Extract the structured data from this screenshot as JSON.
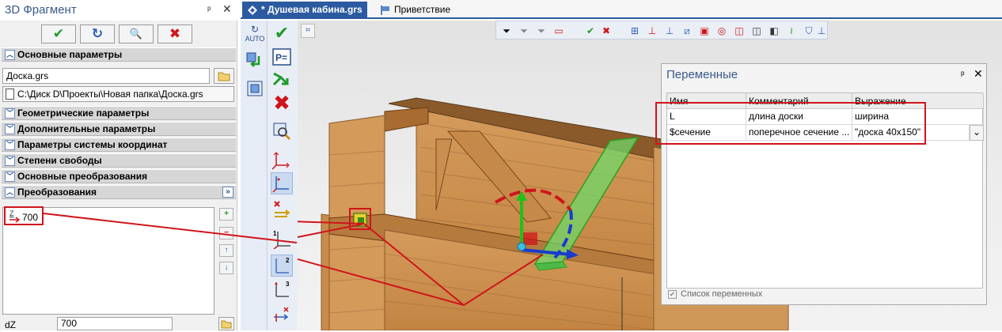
{
  "left_panel": {
    "title": "3D Фрагмент",
    "pin": "ᵖ",
    "close": "✕",
    "buttons": {
      "ok": "✔",
      "refresh": "↻",
      "preview": "🔍",
      "cancel": "✖"
    },
    "sections": {
      "main_params": "Основные параметры",
      "geom_params": "Геометрические параметры",
      "extra_params": "Дополнительные параметры",
      "coord_params": "Параметры системы координат",
      "freedom": "Степени свободы",
      "basic_transforms": "Основные преобразования",
      "transforms": "Преобразования"
    },
    "file_name": "Доска.grs",
    "file_path": "C:\\Диск D\\Проекты\\Новая папка\\Доска.grs",
    "transform_item": {
      "axis": "Z",
      "value": "700"
    },
    "side_buttons": {
      "add": "+",
      "remove": "−",
      "up": "↑",
      "down": "↓"
    },
    "expand": "»",
    "dz_label": "dZ",
    "dz_value": "700"
  },
  "tabs": [
    {
      "label": "* Душевая кабина.grs",
      "active": true
    },
    {
      "label": "Приветствие",
      "active": false
    }
  ],
  "vtb1": {
    "auto": "AUTO"
  },
  "variables_panel": {
    "title": "Переменные",
    "pin": "ᵖ",
    "close": "✕",
    "columns": [
      "Имя",
      "Комментарий",
      "Выражение"
    ],
    "rows": [
      {
        "name": "L",
        "comment": "длина доски",
        "expr": "ширина"
      },
      {
        "name": "$сечение",
        "comment": "поперечное сечение ...",
        "expr": "\"доска 40x150\""
      }
    ],
    "checkbox_label": "Список переменных",
    "dropdown_arrow": "⌄"
  }
}
